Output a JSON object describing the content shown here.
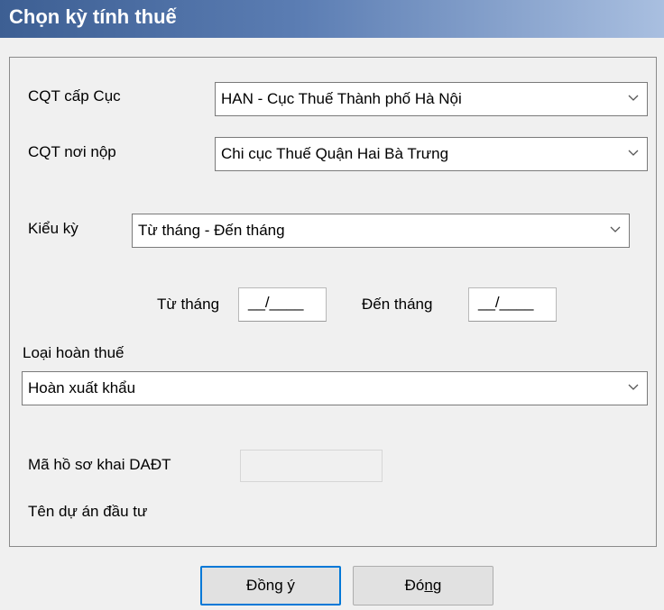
{
  "window": {
    "title": "Chọn kỳ tính thuế"
  },
  "form": {
    "cqt_cap_cuc": {
      "label": "CQT cấp Cục",
      "value": "HAN - Cục Thuế Thành phố Hà Nội"
    },
    "cqt_noi_nop": {
      "label": "CQT nơi nộp",
      "value": "Chi cục Thuế Quận Hai Bà Trưng"
    },
    "kieu_ky": {
      "label": "Kiểu kỳ",
      "value": "Từ tháng - Đến tháng"
    },
    "tu_thang": {
      "label": "Từ tháng",
      "value": "__/____"
    },
    "den_thang": {
      "label": "Đến tháng",
      "value": "__/____"
    },
    "loai_hoan_thue": {
      "label": "Loại hoàn thuế",
      "value": "Hoàn xuất khẩu"
    },
    "ma_ho_so": {
      "label": "Mã hồ sơ khai DAĐT",
      "value": ""
    },
    "ten_du_an": {
      "label": "Tên dự án đầu tư"
    }
  },
  "buttons": {
    "ok": {
      "text_before": "Đồn",
      "mnemonic": "g",
      "text_after": " ý"
    },
    "close": {
      "text_before": "Đó",
      "mnemonic": "n",
      "text_after": "g"
    }
  },
  "icons": {
    "dropdown": "chevron-down-icon"
  },
  "colors": {
    "titlebar": "#3d5f93",
    "default_button_border": "#0078d7"
  }
}
